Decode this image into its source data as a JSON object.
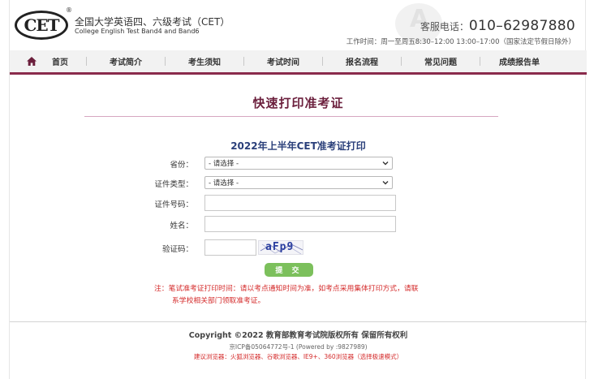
{
  "header": {
    "logo_text": "CET",
    "logo_mark": "®",
    "title_cn": "全国大学英语四、六级考试（CET）",
    "title_en": "College English Test Band4 and Band6",
    "hotline_label": "客服电话：",
    "hotline_number": "010–62987880",
    "hours": "工作时间：周一至周五8:30–12:00 13:00–17:00（国家法定节假日除外）"
  },
  "nav": {
    "home_icon": "home-icon",
    "items": [
      {
        "label": "首页"
      },
      {
        "label": "考试简介"
      },
      {
        "label": "考生须知"
      },
      {
        "label": "考试时间"
      },
      {
        "label": "报名流程"
      },
      {
        "label": "常见问题"
      },
      {
        "label": "成绩报告单"
      }
    ]
  },
  "main": {
    "page_title": "快速打印准考证",
    "form_title": "2022年上半年CET准考证打印",
    "fields": {
      "province_label": "省份：",
      "province_value": "- 请选择 -",
      "id_type_label": "证件类型：",
      "id_type_value": "- 请选择 -",
      "id_number_label": "证件号码：",
      "id_number_value": "",
      "name_label": "姓名：",
      "name_value": "",
      "captcha_label": "验证码：",
      "captcha_value": "",
      "captcha_image_text": "aFp9"
    },
    "submit_label": "提 交",
    "note_line1": "注：笔试准考证打印时间：请以考点通知时间为准，如考点采用集体打印方式，请联",
    "note_line2": "系学校相关部门领取准考证。"
  },
  "footer": {
    "copyright": "Copyright ©2022 教育部教育考试院版权所有 保留所有权利",
    "icp": "京ICP备05064772号-1 (Powered by :9827989)",
    "browser_tip": "建议浏览器：火狐浏览器、谷歌浏览器、IE9+、360浏览器（选择极速模式）"
  },
  "colors": {
    "brand": "#8a2b4c",
    "title": "#6b1f3c",
    "form_title": "#2a3f7a",
    "submit": "#7cc05c",
    "warning": "#d42a2a"
  }
}
